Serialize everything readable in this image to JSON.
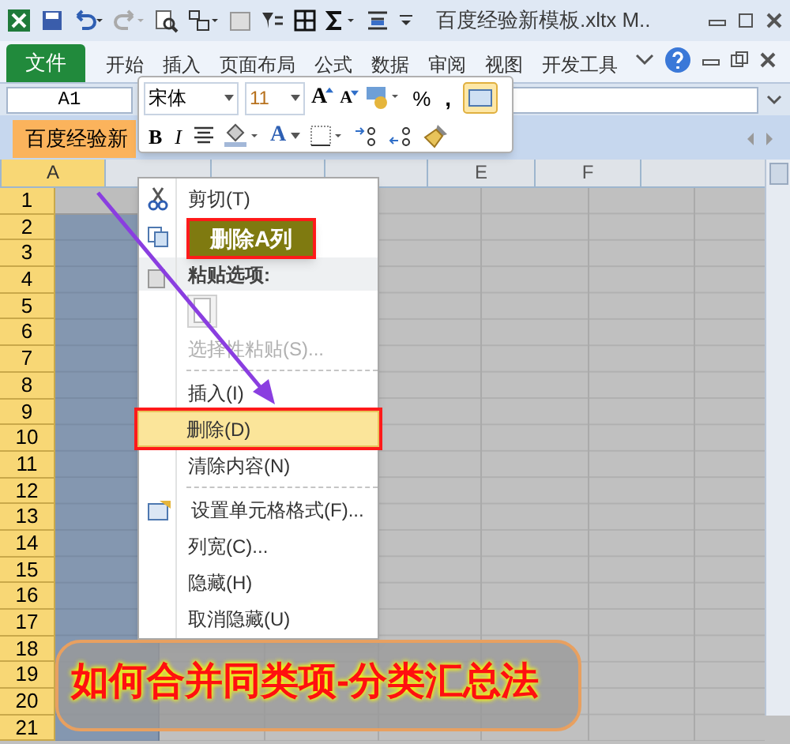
{
  "title_bar": {
    "title": "百度经验新模板.xltx M.."
  },
  "ribbon_tabs": [
    {
      "label": "文件",
      "kind": "file"
    },
    {
      "label": "开始",
      "kind": "tab"
    },
    {
      "label": "插入",
      "kind": "tab"
    },
    {
      "label": "页面布局",
      "kind": "tab"
    },
    {
      "label": "公式",
      "kind": "tab"
    },
    {
      "label": "数据",
      "kind": "tab"
    },
    {
      "label": "审阅",
      "kind": "tab"
    },
    {
      "label": "视图",
      "kind": "tab"
    },
    {
      "label": "开发工具",
      "kind": "tab"
    }
  ],
  "name_box": "A1",
  "sheet_tab": "百度经验新",
  "mini_toolbar": {
    "font": "宋体",
    "size": "11",
    "grow": "A",
    "shrink": "A",
    "percent": "%",
    "comma": ",",
    "bold": "B",
    "italic": "I",
    "font_color": "A"
  },
  "columns": [
    {
      "label": "A",
      "selected": true
    },
    {
      "selected": false
    },
    {
      "selected": false
    },
    {
      "selected": false
    },
    {
      "label": "E",
      "selected": false
    },
    {
      "label": "F",
      "selected": false
    }
  ],
  "rows": [
    "1",
    "2",
    "3",
    "4",
    "5",
    "6",
    "7",
    "8",
    "9",
    "10",
    "11",
    "12",
    "13",
    "14",
    "15",
    "16",
    "17",
    "18",
    "19",
    "20",
    "21"
  ],
  "context_menu": [
    {
      "kind": "item",
      "label": "剪切(T)",
      "disabled": false,
      "selected": false
    },
    {
      "kind": "covered"
    },
    {
      "kind": "header",
      "label": "粘贴选项:"
    },
    {
      "kind": "paste"
    },
    {
      "kind": "item",
      "label": "选择性粘贴(S)...",
      "disabled": true,
      "selected": false
    },
    {
      "kind": "separator"
    },
    {
      "kind": "item",
      "label": "插入(I)",
      "disabled": false,
      "selected": false
    },
    {
      "kind": "item",
      "label": "删除(D)",
      "disabled": false,
      "selected": true
    },
    {
      "kind": "item",
      "label": "清除内容(N)",
      "disabled": false,
      "selected": false
    },
    {
      "kind": "separator"
    },
    {
      "kind": "item",
      "label": "设置单元格格式(F)...",
      "disabled": false,
      "selected": false
    },
    {
      "kind": "item",
      "label": "列宽(C)...",
      "disabled": false,
      "selected": false
    },
    {
      "kind": "item",
      "label": "隐藏(H)",
      "disabled": false,
      "selected": false
    },
    {
      "kind": "item",
      "label": "取消隐藏(U)",
      "disabled": false,
      "selected": false
    }
  ],
  "callout": "删除A列",
  "banner": "如何合并同类项-分类汇总法"
}
